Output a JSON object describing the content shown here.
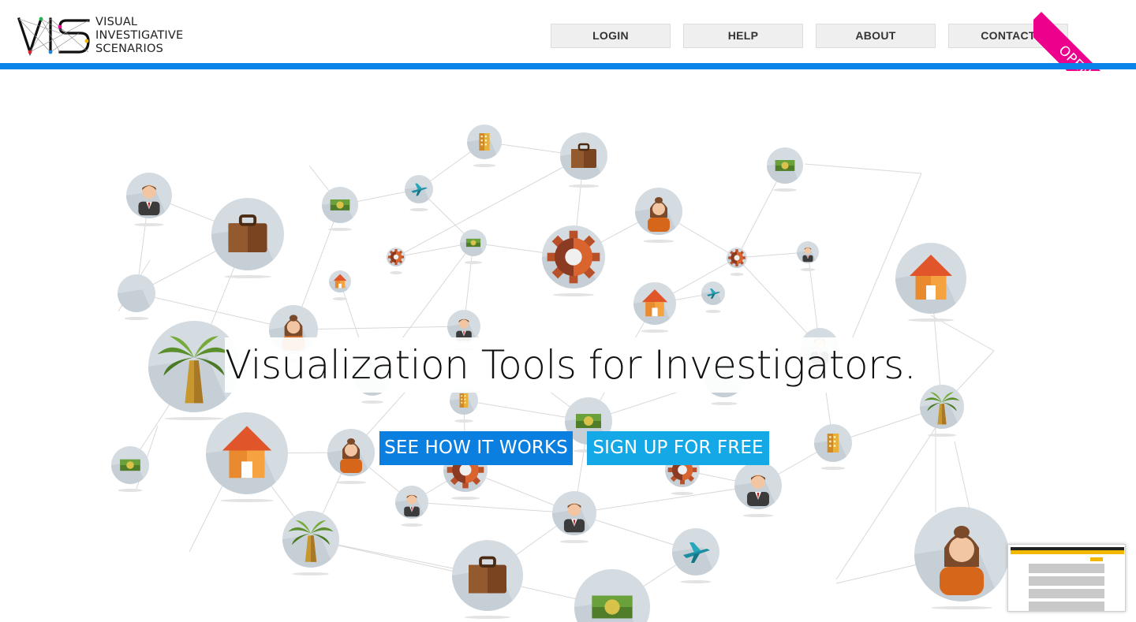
{
  "brand": {
    "logo_mark": "VIS",
    "name_lines": [
      "VISUAL",
      "INVESTIGATIVE",
      "SCENARIOS"
    ]
  },
  "nav": {
    "items": [
      {
        "label": "LOGIN"
      },
      {
        "label": "HELP"
      },
      {
        "label": "ABOUT"
      },
      {
        "label": "CONTACT"
      }
    ]
  },
  "ribbon": {
    "label": "OPEN BETA",
    "color": "#ec008c"
  },
  "colors": {
    "accent_bar": "#0a84e8",
    "cta_primary": "#0a7fe0",
    "cta_secondary": "#14a8e6",
    "node_circle": "#d4dce2",
    "edge": "#d8d8d8"
  },
  "hero": {
    "headline": "Visualization Tools for Investigators.",
    "cta_primary": "SEE HOW IT WORKS",
    "cta_secondary": "SIGN UP FOR FREE"
  },
  "network_icons": [
    "person-icon",
    "briefcase-icon",
    "money-icon",
    "building-icon",
    "airplane-icon",
    "gear-icon",
    "house-icon",
    "palm-tree-icon",
    "woman-icon"
  ]
}
